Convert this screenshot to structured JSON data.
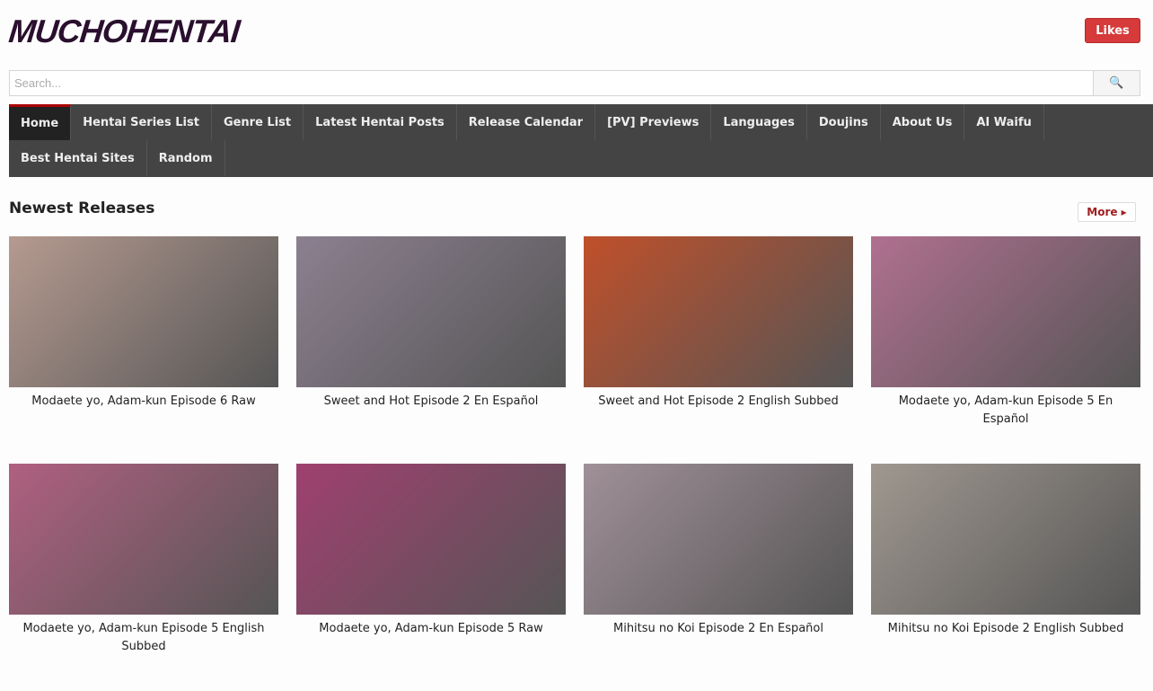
{
  "header": {
    "logo": "MUCHOHENTAI",
    "likes_label": "Likes",
    "search_placeholder": "Search..."
  },
  "nav": [
    "Home",
    "Hentai Series List",
    "Genre List",
    "Latest Hentai Posts",
    "Release Calendar",
    "[PV] Previews",
    "Languages",
    "Doujins",
    "About Us",
    "AI Waifu",
    "Best Hentai Sites",
    "Random"
  ],
  "section": {
    "title": "Newest Releases",
    "more_label": "More ▸"
  },
  "items": [
    {
      "title": "Modaete yo, Adam-kun Episode 6 Raw",
      "color": "#b59a90"
    },
    {
      "title": "Sweet and Hot Episode 2 En Español",
      "color": "#8c8090"
    },
    {
      "title": "Sweet and Hot Episode 2 English Subbed",
      "color": "#c0502a"
    },
    {
      "title": "Modaete yo, Adam-kun Episode 5 En Español",
      "color": "#b07090"
    },
    {
      "title": "Modaete yo, Adam-kun Episode 5 English Subbed",
      "color": "#b06080"
    },
    {
      "title": "Modaete yo, Adam-kun Episode 5 Raw",
      "color": "#a04070"
    },
    {
      "title": "Mihitsu no Koi Episode 2 En Español",
      "color": "#a09098"
    },
    {
      "title": "Mihitsu no Koi Episode 2 English Subbed",
      "color": "#a09890"
    }
  ]
}
